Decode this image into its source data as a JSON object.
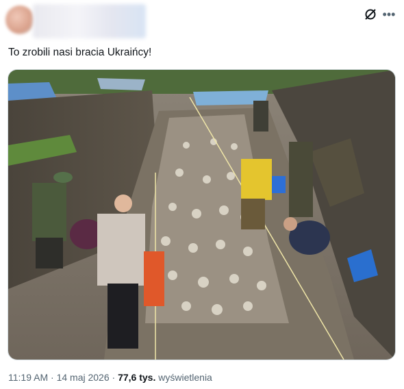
{
  "tweet": {
    "text": "To zrobili nasi bracia Ukraińcy!",
    "time": "11:19 AM",
    "separator": "·",
    "date": "14 maj 2026",
    "views_count": "77,6 tys.",
    "views_label": "wyświetlenia"
  },
  "icons": {
    "grok": "grok-icon",
    "more": "more-icon"
  },
  "colors": {
    "text": "#0f1419",
    "secondary": "#536471",
    "border": "#cfd9de"
  }
}
